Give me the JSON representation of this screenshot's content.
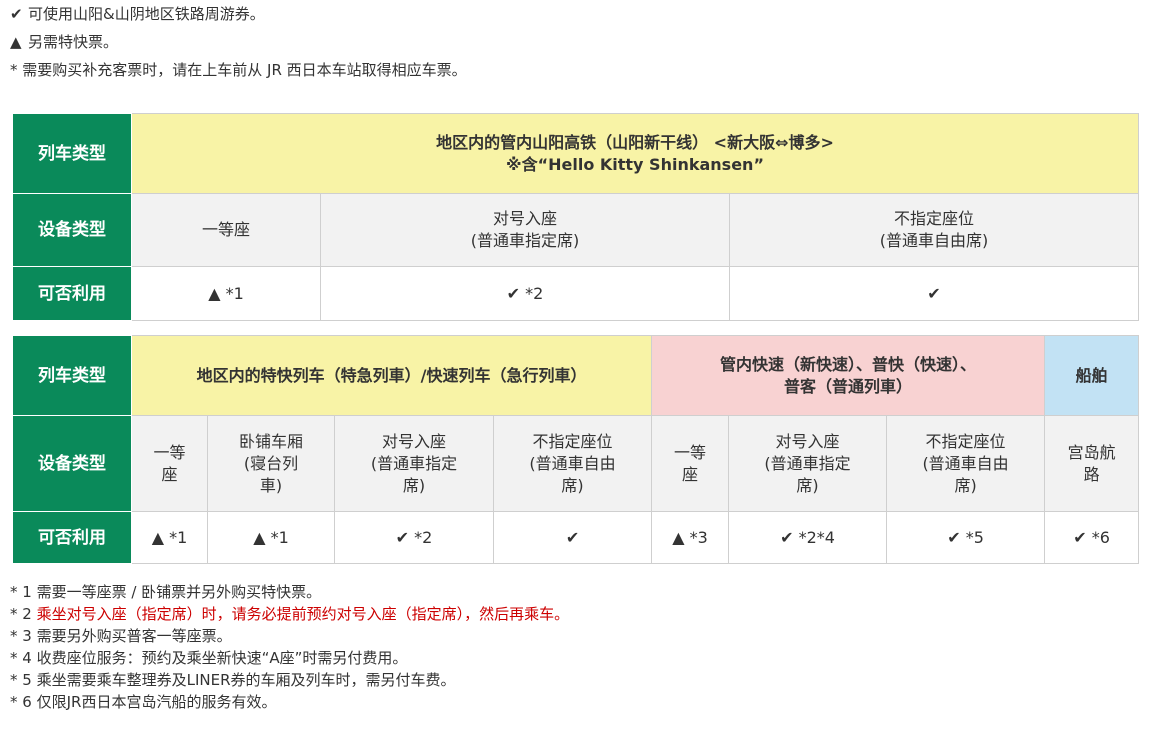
{
  "legend": [
    {
      "icon": "check-icon",
      "symbol": "✔",
      "text": "可使用山阳&山阴地区铁路周游券。"
    },
    {
      "icon": "triangle-icon",
      "symbol": "▲",
      "text": "另需特快票。"
    },
    {
      "icon": "asterisk",
      "symbol": "*",
      "text": "需要购买补充客票时，请在上车前从 JR 西日本车站取得相应车票。"
    }
  ],
  "table1": {
    "row_labels": {
      "train_type": "列车类型",
      "equipment": "设备类型",
      "availability": "可否利用"
    },
    "title_line1": "地区内的管内山阳高铁（山阳新干线） <新大阪⇔博多>",
    "title_line2": "※含“Hello Kitty Shinkansen”",
    "equipment": [
      {
        "line1": "一等座",
        "line2": ""
      },
      {
        "line1": "对号入座",
        "line2": "(普通車指定席)"
      },
      {
        "line1": "不指定座位",
        "line2": "(普通車自由席)"
      }
    ],
    "availability": [
      "▲ *1",
      "✔ *2",
      "✔"
    ]
  },
  "table2": {
    "row_labels": {
      "train_type": "列车类型",
      "equipment": "设备类型",
      "availability": "可否利用"
    },
    "groups": [
      {
        "label": "地区内的特快列车（特急列車）/快速列车（急行列車）",
        "color": "#f8f3a6"
      },
      {
        "label_line1": "管内快速（新快速）、普快（快速）、",
        "label_line2": "普客（普通列車）",
        "color": "#f8d2d2"
      },
      {
        "label": "船舶",
        "color": "#c2e2f4"
      }
    ],
    "equipment": [
      "一等\n座",
      "卧铺车厢\n(寝台列\n車)",
      "对号入座\n(普通車指定\n席)",
      "不指定座位\n(普通車自由\n席)",
      "一等\n座",
      "对号入座\n(普通車指定\n席)",
      "不指定座位\n(普通車自由\n席)",
      "宫岛航\n路"
    ],
    "availability": [
      "▲ *1",
      "▲ *1",
      "✔ *2",
      "✔",
      "▲ *3",
      "✔ *2*4",
      "✔ *5",
      "✔ *6"
    ]
  },
  "notes": [
    {
      "mark": "* 1 ",
      "text": "需要一等座票 / 卧铺票并另外购买特快票。",
      "red": false
    },
    {
      "mark": "* 2 ",
      "text": "乘坐对号入座（指定席）时，请务必提前预约对号入座（指定席），然后再乘车。",
      "red": true
    },
    {
      "mark": "* 3 ",
      "text": "需要另外购买普客一等座票。",
      "red": false
    },
    {
      "mark": "* 4 ",
      "text": "收费座位服务：预约及乘坐新快速“A座”时需另付费用。",
      "red": false
    },
    {
      "mark": "* 5 ",
      "text": "乘坐需要乘车整理券及LINER券的车厢及列车时，需另付车费。",
      "red": false
    },
    {
      "mark": "* 6 ",
      "text": "仅限JR西日本宫岛汽船的服务有效。",
      "red": false
    }
  ],
  "colors": {
    "header_green": "#0a8a5a",
    "yellow": "#f8f3a6",
    "pink": "#f8d2d2",
    "blue": "#c2e2f4",
    "note_red": "#cc0000"
  }
}
